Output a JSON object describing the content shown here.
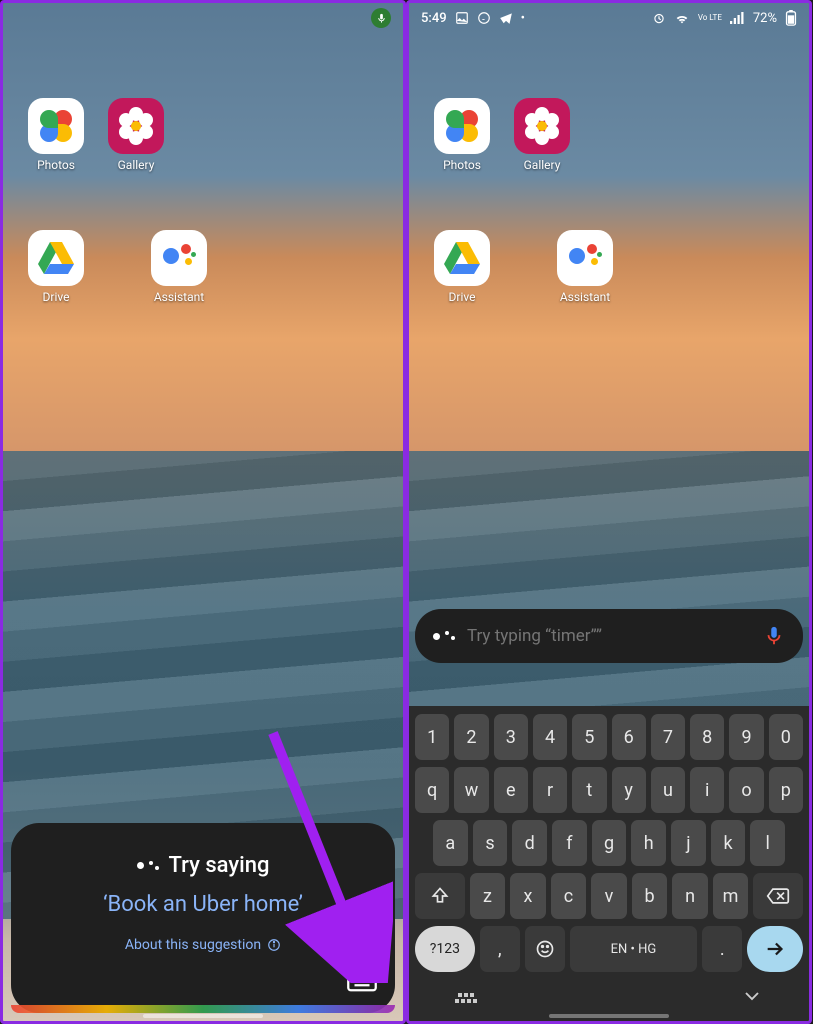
{
  "left": {
    "apps": [
      {
        "label": "Photos"
      },
      {
        "label": "Gallery"
      },
      {
        "label": "Drive"
      },
      {
        "label": "Assistant"
      }
    ],
    "assistant": {
      "title": "Try saying",
      "suggestion": "‘Book an Uber home’",
      "about": "About this suggestion"
    }
  },
  "right": {
    "status": {
      "time": "5:49",
      "battery": "72%",
      "lte": "Vo LTE"
    },
    "apps": [
      {
        "label": "Photos"
      },
      {
        "label": "Gallery"
      },
      {
        "label": "Drive"
      },
      {
        "label": "Assistant"
      }
    ],
    "input": {
      "placeholder": "Try typing “timer””"
    },
    "keyboard": {
      "row_num": [
        "1",
        "2",
        "3",
        "4",
        "5",
        "6",
        "7",
        "8",
        "9",
        "0"
      ],
      "row1": [
        "q",
        "w",
        "e",
        "r",
        "t",
        "y",
        "u",
        "i",
        "o",
        "p"
      ],
      "row2": [
        "a",
        "s",
        "d",
        "f",
        "g",
        "h",
        "j",
        "k",
        "l"
      ],
      "row3": [
        "z",
        "x",
        "c",
        "v",
        "b",
        "n",
        "m"
      ],
      "sym": "?123",
      "comma": ",",
      "space": "EN • HG",
      "period": "."
    }
  }
}
